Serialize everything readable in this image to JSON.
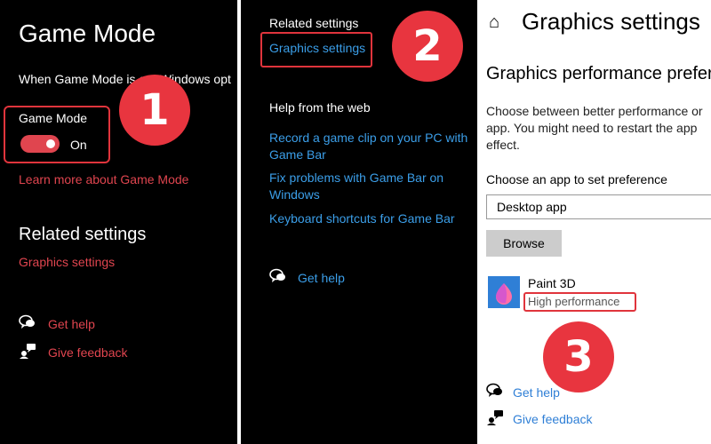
{
  "panel1": {
    "title": "Game Mode",
    "description": "When Game Mode is on, Windows opt",
    "game_mode_label": "Game Mode",
    "toggle_state": "On",
    "learn_more": "Learn more about Game Mode",
    "related_heading": "Related settings",
    "graphics_link": "Graphics settings",
    "get_help": "Get help",
    "give_feedback": "Give feedback",
    "accent_color": "#e0454f"
  },
  "panel2": {
    "related_heading": "Related settings",
    "graphics_link": "Graphics settings",
    "help_heading": "Help from the web",
    "links": [
      "Record a game clip on your PC with Game Bar",
      "Fix problems with Game Bar on Windows",
      "Keyboard shortcuts for Game Bar"
    ],
    "get_help": "Get help",
    "link_color": "#3b9ee8"
  },
  "panel3": {
    "home_icon": "⌂",
    "title": "Graphics settings",
    "subtitle": "Graphics performance prefere",
    "description": "Choose between better performance or app. You might need to restart the app effect.",
    "choose_label": "Choose an app to set preference",
    "select_value": "Desktop app",
    "browse_label": "Browse",
    "app_name": "Paint 3D",
    "app_performance": "High performance",
    "get_help": "Get help",
    "give_feedback": "Give feedback",
    "link_color": "#2f7fd6"
  },
  "annotations": {
    "step1": "1",
    "step2": "2",
    "step3": "3",
    "highlight_color": "#e0343c"
  }
}
